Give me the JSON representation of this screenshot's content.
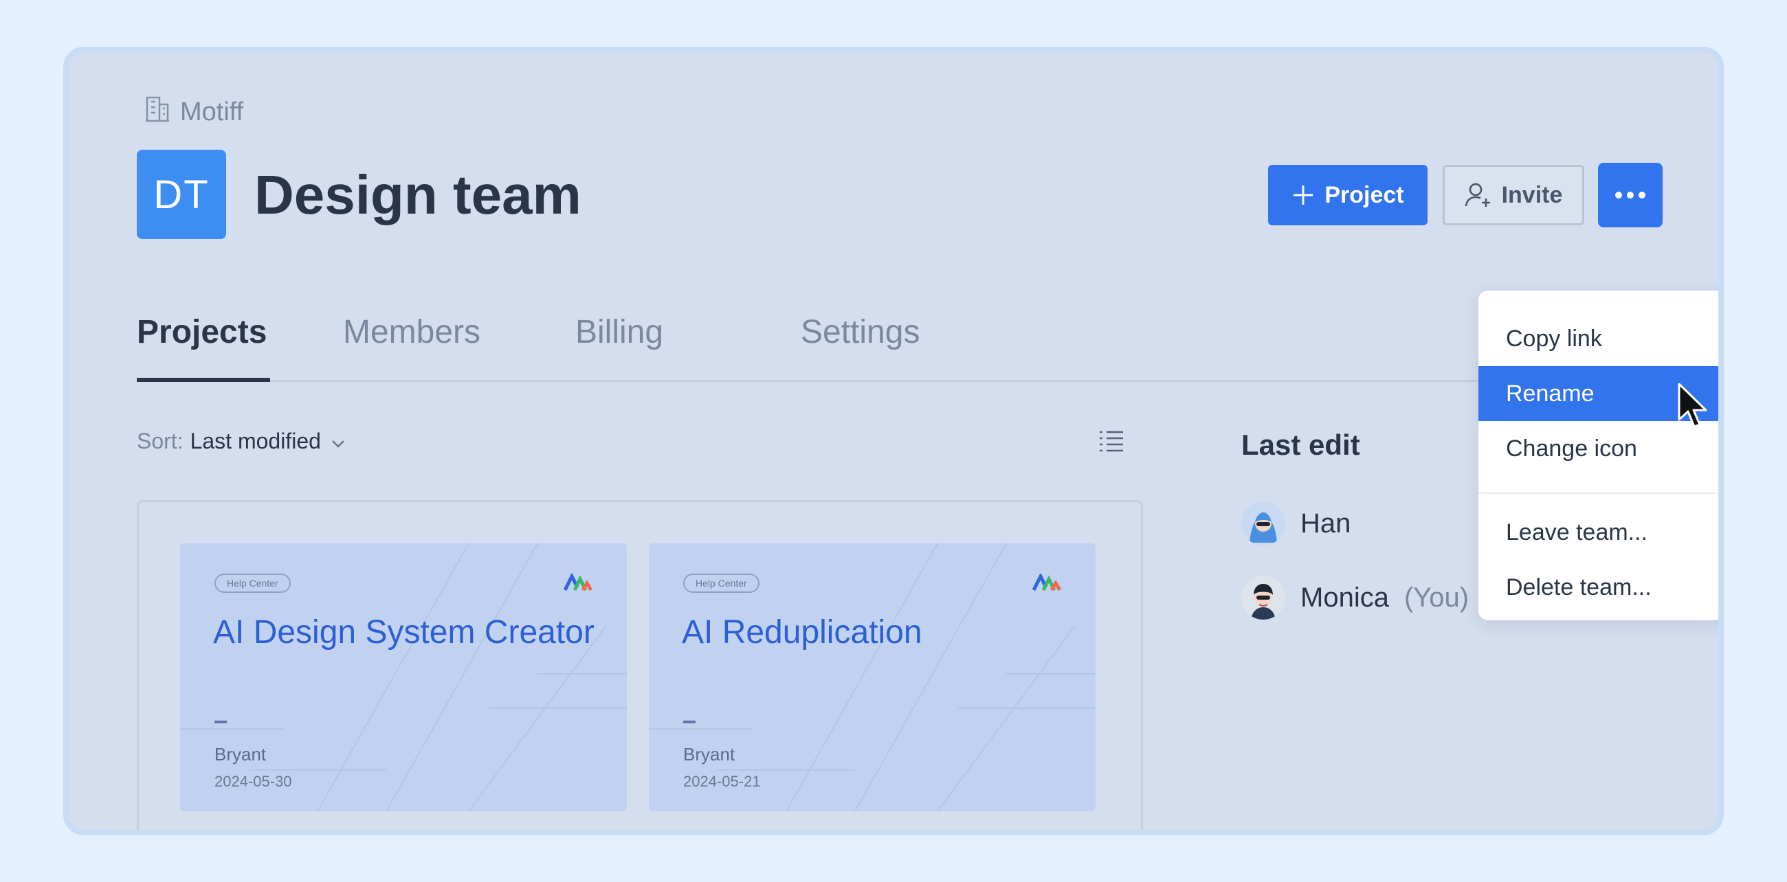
{
  "org": {
    "name": "Motiff"
  },
  "team": {
    "initials": "DT",
    "name": "Design team"
  },
  "actions": {
    "project_label": "Project",
    "invite_label": "Invite"
  },
  "tabs": [
    {
      "label": "Projects"
    },
    {
      "label": "Members"
    },
    {
      "label": "Billing"
    },
    {
      "label": "Settings"
    }
  ],
  "sort": {
    "label": "Sort:",
    "value": "Last modified"
  },
  "projects": [
    {
      "tag": "Help Center",
      "title": "AI Design System Creator",
      "author": "Bryant",
      "date": "2024-05-30"
    },
    {
      "tag": "Help Center",
      "title": "AI Reduplication",
      "author": "Bryant",
      "date": "2024-05-21"
    }
  ],
  "last_edit": {
    "title": "Last edit",
    "editors": [
      {
        "name": "Han",
        "suffix": ""
      },
      {
        "name": "Monica",
        "suffix": "(You)"
      }
    ]
  },
  "menu": {
    "items": [
      "Copy link",
      "Rename",
      "Change icon",
      "Leave team...",
      "Delete team..."
    ],
    "highlighted": "Rename"
  },
  "colors": {
    "accent": "#3273ee",
    "avatar": "#3d8ef0",
    "background": "#e4f0fd"
  }
}
